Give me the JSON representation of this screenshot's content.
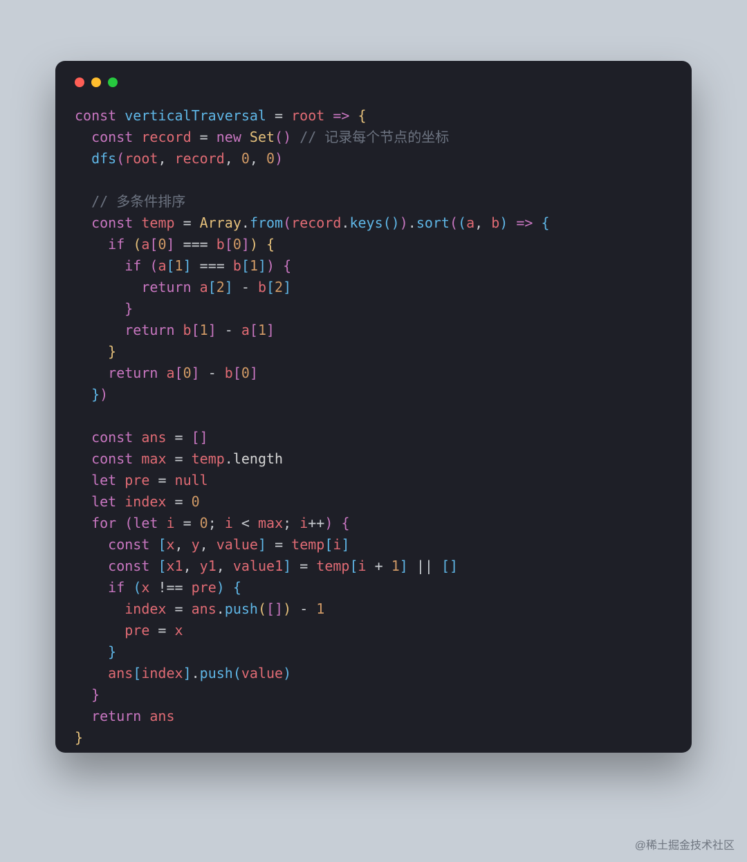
{
  "watermark": "@稀土掘金技术社区",
  "colors": {
    "bg": "#c7ced6",
    "card": "#1e1f27",
    "red": "#ff5f56",
    "yellow": "#ffbd2e",
    "green": "#27c93f"
  },
  "code_plain": "const verticalTraversal = root => {\n  const record = new Set() // 记录每个节点的坐标\n  dfs(root, record, 0, 0)\n\n  // 多条件排序\n  const temp = Array.from(record.keys()).sort((a, b) => {\n    if (a[0] === b[0]) {\n      if (a[1] === b[1]) {\n        return a[2] - b[2]\n      }\n      return b[1] - a[1]\n    }\n    return a[0] - b[0]\n  })\n\n  const ans = []\n  const max = temp.length\n  let pre = null\n  let index = 0\n  for (let i = 0; i < max; i++) {\n    const [x, y, value] = temp[i]\n    const [x1, y1, value1] = temp[i + 1] || []\n    if (x !== pre) {\n      index = ans.push([]) - 1\n      pre = x\n    }\n    ans[index].push(value)\n  }\n  return ans\n}",
  "code": [
    [
      [
        "key",
        "const"
      ],
      [
        "sp",
        " "
      ],
      [
        "fn",
        "verticalTraversal"
      ],
      [
        "sp",
        " "
      ],
      [
        "op",
        "="
      ],
      [
        "sp",
        " "
      ],
      [
        "param",
        "root"
      ],
      [
        "sp",
        " "
      ],
      [
        "key",
        "=>"
      ],
      [
        "sp",
        " "
      ],
      [
        "by",
        "{"
      ]
    ],
    [
      [
        "sp",
        "  "
      ],
      [
        "key",
        "const"
      ],
      [
        "sp",
        " "
      ],
      [
        "param",
        "record"
      ],
      [
        "sp",
        " "
      ],
      [
        "op",
        "="
      ],
      [
        "sp",
        " "
      ],
      [
        "key",
        "new"
      ],
      [
        "sp",
        " "
      ],
      [
        "type",
        "Set"
      ],
      [
        "bp",
        "("
      ],
      [
        "bp",
        ")"
      ],
      [
        "sp",
        " "
      ],
      [
        "cmt",
        "// 记录每个节点的坐标"
      ]
    ],
    [
      [
        "sp",
        "  "
      ],
      [
        "fn",
        "dfs"
      ],
      [
        "bp",
        "("
      ],
      [
        "param",
        "root"
      ],
      [
        "punc",
        ", "
      ],
      [
        "param",
        "record"
      ],
      [
        "punc",
        ", "
      ],
      [
        "num",
        "0"
      ],
      [
        "punc",
        ", "
      ],
      [
        "num",
        "0"
      ],
      [
        "bp",
        ")"
      ]
    ],
    [
      [
        "sp",
        ""
      ]
    ],
    [
      [
        "sp",
        "  "
      ],
      [
        "cmt",
        "// 多条件排序"
      ]
    ],
    [
      [
        "sp",
        "  "
      ],
      [
        "key",
        "const"
      ],
      [
        "sp",
        " "
      ],
      [
        "param",
        "temp"
      ],
      [
        "sp",
        " "
      ],
      [
        "op",
        "="
      ],
      [
        "sp",
        " "
      ],
      [
        "type",
        "Array"
      ],
      [
        "punc",
        "."
      ],
      [
        "fn",
        "from"
      ],
      [
        "bp",
        "("
      ],
      [
        "param",
        "record"
      ],
      [
        "punc",
        "."
      ],
      [
        "fn",
        "keys"
      ],
      [
        "bb",
        "("
      ],
      [
        "bb",
        ")"
      ],
      [
        "bp",
        ")"
      ],
      [
        "punc",
        "."
      ],
      [
        "fn",
        "sort"
      ],
      [
        "bp",
        "("
      ],
      [
        "bb",
        "("
      ],
      [
        "param",
        "a"
      ],
      [
        "punc",
        ", "
      ],
      [
        "param",
        "b"
      ],
      [
        "bb",
        ")"
      ],
      [
        "sp",
        " "
      ],
      [
        "key",
        "=>"
      ],
      [
        "sp",
        " "
      ],
      [
        "bb",
        "{"
      ]
    ],
    [
      [
        "sp",
        "    "
      ],
      [
        "key",
        "if"
      ],
      [
        "sp",
        " "
      ],
      [
        "by",
        "("
      ],
      [
        "param",
        "a"
      ],
      [
        "bp",
        "["
      ],
      [
        "num",
        "0"
      ],
      [
        "bp",
        "]"
      ],
      [
        "sp",
        " "
      ],
      [
        "op",
        "==="
      ],
      [
        "sp",
        " "
      ],
      [
        "param",
        "b"
      ],
      [
        "bp",
        "["
      ],
      [
        "num",
        "0"
      ],
      [
        "bp",
        "]"
      ],
      [
        "by",
        ")"
      ],
      [
        "sp",
        " "
      ],
      [
        "by",
        "{"
      ]
    ],
    [
      [
        "sp",
        "      "
      ],
      [
        "key",
        "if"
      ],
      [
        "sp",
        " "
      ],
      [
        "bp",
        "("
      ],
      [
        "param",
        "a"
      ],
      [
        "bb",
        "["
      ],
      [
        "num",
        "1"
      ],
      [
        "bb",
        "]"
      ],
      [
        "sp",
        " "
      ],
      [
        "op",
        "==="
      ],
      [
        "sp",
        " "
      ],
      [
        "param",
        "b"
      ],
      [
        "bb",
        "["
      ],
      [
        "num",
        "1"
      ],
      [
        "bb",
        "]"
      ],
      [
        "bp",
        ")"
      ],
      [
        "sp",
        " "
      ],
      [
        "bp",
        "{"
      ]
    ],
    [
      [
        "sp",
        "        "
      ],
      [
        "key",
        "return"
      ],
      [
        "sp",
        " "
      ],
      [
        "param",
        "a"
      ],
      [
        "bb",
        "["
      ],
      [
        "num",
        "2"
      ],
      [
        "bb",
        "]"
      ],
      [
        "sp",
        " "
      ],
      [
        "op",
        "-"
      ],
      [
        "sp",
        " "
      ],
      [
        "param",
        "b"
      ],
      [
        "bb",
        "["
      ],
      [
        "num",
        "2"
      ],
      [
        "bb",
        "]"
      ]
    ],
    [
      [
        "sp",
        "      "
      ],
      [
        "bp",
        "}"
      ]
    ],
    [
      [
        "sp",
        "      "
      ],
      [
        "key",
        "return"
      ],
      [
        "sp",
        " "
      ],
      [
        "param",
        "b"
      ],
      [
        "bp",
        "["
      ],
      [
        "num",
        "1"
      ],
      [
        "bp",
        "]"
      ],
      [
        "sp",
        " "
      ],
      [
        "op",
        "-"
      ],
      [
        "sp",
        " "
      ],
      [
        "param",
        "a"
      ],
      [
        "bp",
        "["
      ],
      [
        "num",
        "1"
      ],
      [
        "bp",
        "]"
      ]
    ],
    [
      [
        "sp",
        "    "
      ],
      [
        "by",
        "}"
      ]
    ],
    [
      [
        "sp",
        "    "
      ],
      [
        "key",
        "return"
      ],
      [
        "sp",
        " "
      ],
      [
        "param",
        "a"
      ],
      [
        "bp",
        "["
      ],
      [
        "num",
        "0"
      ],
      [
        "bp",
        "]"
      ],
      [
        "sp",
        " "
      ],
      [
        "op",
        "-"
      ],
      [
        "sp",
        " "
      ],
      [
        "param",
        "b"
      ],
      [
        "bp",
        "["
      ],
      [
        "num",
        "0"
      ],
      [
        "bp",
        "]"
      ]
    ],
    [
      [
        "sp",
        "  "
      ],
      [
        "bb",
        "}"
      ],
      [
        "bp",
        ")"
      ]
    ],
    [
      [
        "sp",
        ""
      ]
    ],
    [
      [
        "sp",
        "  "
      ],
      [
        "key",
        "const"
      ],
      [
        "sp",
        " "
      ],
      [
        "param",
        "ans"
      ],
      [
        "sp",
        " "
      ],
      [
        "op",
        "="
      ],
      [
        "sp",
        " "
      ],
      [
        "bp",
        "["
      ],
      [
        "bp",
        "]"
      ]
    ],
    [
      [
        "sp",
        "  "
      ],
      [
        "key",
        "const"
      ],
      [
        "sp",
        " "
      ],
      [
        "param",
        "max"
      ],
      [
        "sp",
        " "
      ],
      [
        "op",
        "="
      ],
      [
        "sp",
        " "
      ],
      [
        "param",
        "temp"
      ],
      [
        "punc",
        "."
      ],
      [
        "prop",
        "length"
      ]
    ],
    [
      [
        "sp",
        "  "
      ],
      [
        "key",
        "let"
      ],
      [
        "sp",
        " "
      ],
      [
        "param",
        "pre"
      ],
      [
        "sp",
        " "
      ],
      [
        "op",
        "="
      ],
      [
        "sp",
        " "
      ],
      [
        "param",
        "null"
      ]
    ],
    [
      [
        "sp",
        "  "
      ],
      [
        "key",
        "let"
      ],
      [
        "sp",
        " "
      ],
      [
        "param",
        "index"
      ],
      [
        "sp",
        " "
      ],
      [
        "op",
        "="
      ],
      [
        "sp",
        " "
      ],
      [
        "num",
        "0"
      ]
    ],
    [
      [
        "sp",
        "  "
      ],
      [
        "key",
        "for"
      ],
      [
        "sp",
        " "
      ],
      [
        "bp",
        "("
      ],
      [
        "key",
        "let"
      ],
      [
        "sp",
        " "
      ],
      [
        "param",
        "i"
      ],
      [
        "sp",
        " "
      ],
      [
        "op",
        "="
      ],
      [
        "sp",
        " "
      ],
      [
        "num",
        "0"
      ],
      [
        "punc",
        "; "
      ],
      [
        "param",
        "i"
      ],
      [
        "sp",
        " "
      ],
      [
        "op",
        "<"
      ],
      [
        "sp",
        " "
      ],
      [
        "param",
        "max"
      ],
      [
        "punc",
        "; "
      ],
      [
        "param",
        "i"
      ],
      [
        "op",
        "++"
      ],
      [
        "bp",
        ")"
      ],
      [
        "sp",
        " "
      ],
      [
        "bp",
        "{"
      ]
    ],
    [
      [
        "sp",
        "    "
      ],
      [
        "key",
        "const"
      ],
      [
        "sp",
        " "
      ],
      [
        "bb",
        "["
      ],
      [
        "param",
        "x"
      ],
      [
        "punc",
        ", "
      ],
      [
        "param",
        "y"
      ],
      [
        "punc",
        ", "
      ],
      [
        "param",
        "value"
      ],
      [
        "bb",
        "]"
      ],
      [
        "sp",
        " "
      ],
      [
        "op",
        "="
      ],
      [
        "sp",
        " "
      ],
      [
        "param",
        "temp"
      ],
      [
        "bb",
        "["
      ],
      [
        "param",
        "i"
      ],
      [
        "bb",
        "]"
      ]
    ],
    [
      [
        "sp",
        "    "
      ],
      [
        "key",
        "const"
      ],
      [
        "sp",
        " "
      ],
      [
        "bb",
        "["
      ],
      [
        "param",
        "x1"
      ],
      [
        "punc",
        ", "
      ],
      [
        "param",
        "y1"
      ],
      [
        "punc",
        ", "
      ],
      [
        "param",
        "value1"
      ],
      [
        "bb",
        "]"
      ],
      [
        "sp",
        " "
      ],
      [
        "op",
        "="
      ],
      [
        "sp",
        " "
      ],
      [
        "param",
        "temp"
      ],
      [
        "bb",
        "["
      ],
      [
        "param",
        "i"
      ],
      [
        "sp",
        " "
      ],
      [
        "op",
        "+"
      ],
      [
        "sp",
        " "
      ],
      [
        "num",
        "1"
      ],
      [
        "bb",
        "]"
      ],
      [
        "sp",
        " "
      ],
      [
        "op",
        "||"
      ],
      [
        "sp",
        " "
      ],
      [
        "bb",
        "["
      ],
      [
        "bb",
        "]"
      ]
    ],
    [
      [
        "sp",
        "    "
      ],
      [
        "key",
        "if"
      ],
      [
        "sp",
        " "
      ],
      [
        "bb",
        "("
      ],
      [
        "param",
        "x"
      ],
      [
        "sp",
        " "
      ],
      [
        "op",
        "!=="
      ],
      [
        "sp",
        " "
      ],
      [
        "param",
        "pre"
      ],
      [
        "bb",
        ")"
      ],
      [
        "sp",
        " "
      ],
      [
        "bb",
        "{"
      ]
    ],
    [
      [
        "sp",
        "      "
      ],
      [
        "param",
        "index"
      ],
      [
        "sp",
        " "
      ],
      [
        "op",
        "="
      ],
      [
        "sp",
        " "
      ],
      [
        "param",
        "ans"
      ],
      [
        "punc",
        "."
      ],
      [
        "fn",
        "push"
      ],
      [
        "by",
        "("
      ],
      [
        "bp",
        "["
      ],
      [
        "bp",
        "]"
      ],
      [
        "by",
        ")"
      ],
      [
        "sp",
        " "
      ],
      [
        "op",
        "-"
      ],
      [
        "sp",
        " "
      ],
      [
        "num",
        "1"
      ]
    ],
    [
      [
        "sp",
        "      "
      ],
      [
        "param",
        "pre"
      ],
      [
        "sp",
        " "
      ],
      [
        "op",
        "="
      ],
      [
        "sp",
        " "
      ],
      [
        "param",
        "x"
      ]
    ],
    [
      [
        "sp",
        "    "
      ],
      [
        "bb",
        "}"
      ]
    ],
    [
      [
        "sp",
        "    "
      ],
      [
        "param",
        "ans"
      ],
      [
        "bb",
        "["
      ],
      [
        "param",
        "index"
      ],
      [
        "bb",
        "]"
      ],
      [
        "punc",
        "."
      ],
      [
        "fn",
        "push"
      ],
      [
        "bb",
        "("
      ],
      [
        "param",
        "value"
      ],
      [
        "bb",
        ")"
      ]
    ],
    [
      [
        "sp",
        "  "
      ],
      [
        "bp",
        "}"
      ]
    ],
    [
      [
        "sp",
        "  "
      ],
      [
        "key",
        "return"
      ],
      [
        "sp",
        " "
      ],
      [
        "param",
        "ans"
      ]
    ],
    [
      [
        "by",
        "}"
      ]
    ]
  ]
}
